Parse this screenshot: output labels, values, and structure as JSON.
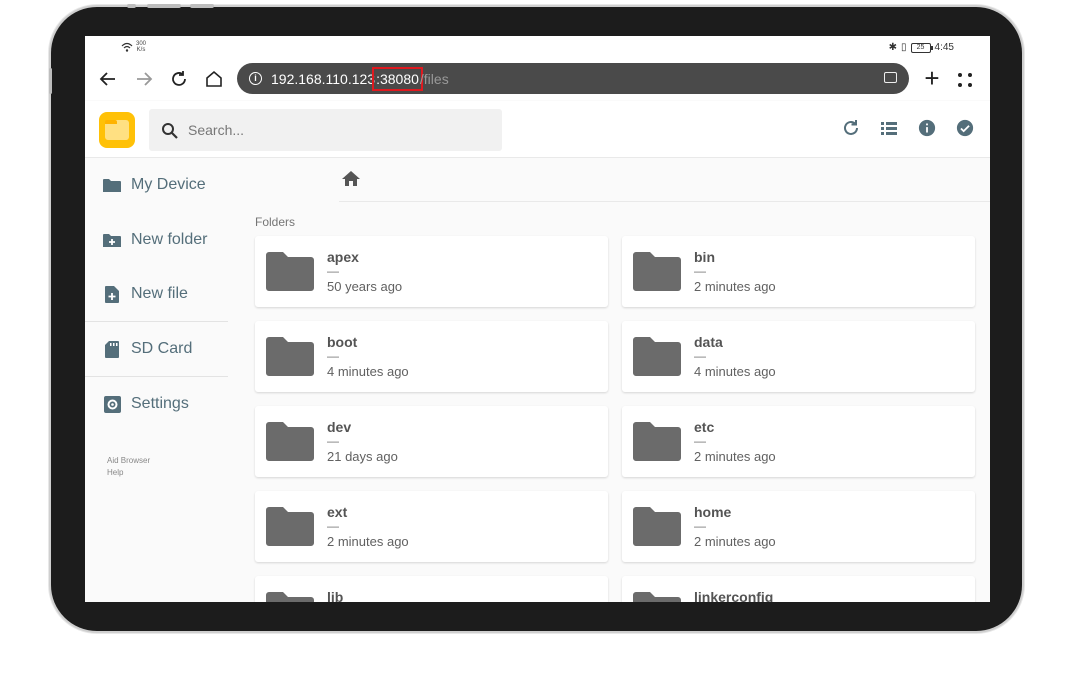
{
  "status_bar": {
    "net_speed_value": "300",
    "net_speed_unit": "K/s",
    "time": "4:45",
    "battery": "25"
  },
  "browser": {
    "url_host": "192.168.110.123",
    "url_port": ":38080",
    "url_path": "/files"
  },
  "search": {
    "placeholder": "Search..."
  },
  "header_icons": [
    "reload-icon",
    "list-view-icon",
    "info-icon",
    "check-circle-icon"
  ],
  "sidebar": {
    "items": [
      {
        "label": "My Device",
        "icon": "folder-icon"
      },
      {
        "label": "New folder",
        "icon": "new-folder-icon"
      },
      {
        "label": "New file",
        "icon": "new-file-icon"
      },
      {
        "label": "SD Card",
        "icon": "sd-card-icon"
      },
      {
        "label": "Settings",
        "icon": "settings-icon"
      }
    ],
    "footer": {
      "line1": "Aid Browser",
      "line2": "Help"
    }
  },
  "main": {
    "section_label": "Folders",
    "folders": [
      {
        "name": "apex",
        "size": "—",
        "modified": "50 years ago"
      },
      {
        "name": "bin",
        "size": "—",
        "modified": "2 minutes ago"
      },
      {
        "name": "boot",
        "size": "—",
        "modified": "4 minutes ago"
      },
      {
        "name": "data",
        "size": "—",
        "modified": "4 minutes ago"
      },
      {
        "name": "dev",
        "size": "—",
        "modified": "21 days ago"
      },
      {
        "name": "etc",
        "size": "—",
        "modified": "2 minutes ago"
      },
      {
        "name": "ext",
        "size": "—",
        "modified": "2 minutes ago"
      },
      {
        "name": "home",
        "size": "—",
        "modified": "2 minutes ago"
      },
      {
        "name": "lib",
        "size": "",
        "modified": ""
      },
      {
        "name": "linkerconfig",
        "size": "",
        "modified": ""
      }
    ]
  },
  "colors": {
    "accent": "#546e7a",
    "url_highlight": "#e0191f",
    "logo": "#ffc107",
    "folder": "#6b6b6b"
  }
}
